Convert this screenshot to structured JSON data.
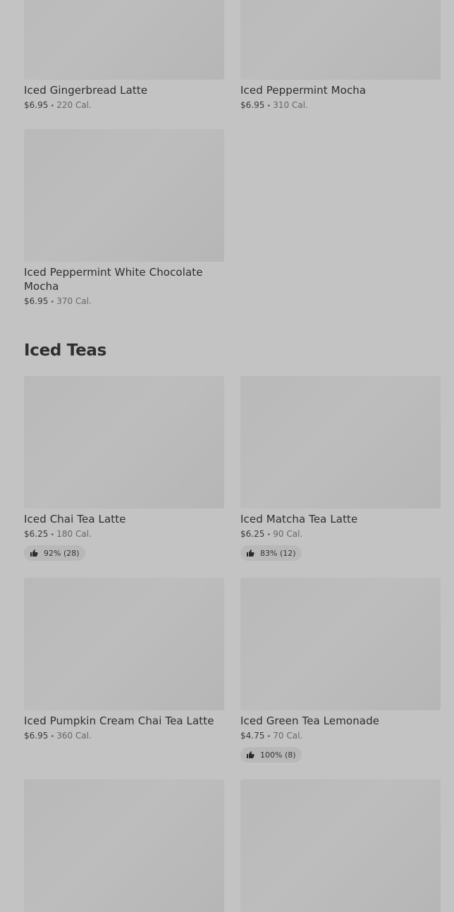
{
  "top_items": [
    {
      "name": "Iced Gingerbread Latte",
      "price": "$6.95",
      "calories": "220 Cal."
    },
    {
      "name": "Iced Peppermint Mocha",
      "price": "$6.95",
      "calories": "310 Cal."
    },
    {
      "name": "Iced Peppermint White Chocolate Mocha",
      "price": "$6.95",
      "calories": "370 Cal."
    }
  ],
  "section": {
    "title": "Iced Teas"
  },
  "teas": [
    {
      "name": "Iced Chai Tea Latte",
      "price": "$6.25",
      "calories": "180 Cal.",
      "rating": "92% (28)",
      "rating_fraction": 0.92
    },
    {
      "name": "Iced Matcha Tea Latte",
      "price": "$6.25",
      "calories": "90 Cal.",
      "rating": "83% (12)",
      "rating_fraction": 0.83
    },
    {
      "name": "Iced Pumpkin Cream Chai Tea Latte",
      "price": "$6.95",
      "calories": "360 Cal."
    },
    {
      "name": "Iced Green Tea Lemonade",
      "price": "$4.75",
      "calories": "70 Cal.",
      "rating": "100% (8)",
      "rating_fraction": 1.0
    }
  ],
  "separator": "•",
  "icons": {
    "rating": "thumbs-up-icon"
  }
}
